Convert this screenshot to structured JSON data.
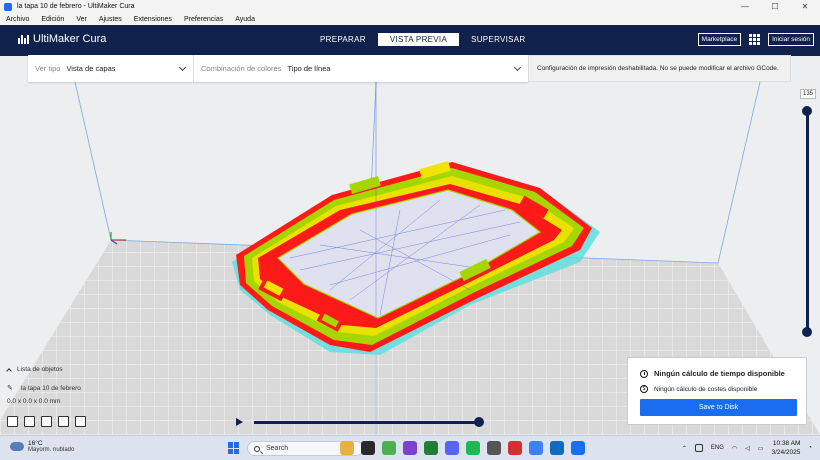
{
  "window": {
    "title": "la tapa 10 de febrero - UltiMaker Cura",
    "controls": [
      "—",
      "☐",
      "✕"
    ]
  },
  "menu": [
    "Archivo",
    "Edición",
    "Ver",
    "Ajustes",
    "Extensiones",
    "Preferencias",
    "Ayuda"
  ],
  "header": {
    "brand": "UltiMaker Cura",
    "stages": [
      "PREPARAR",
      "VISTA PREVIA",
      "SUPERVISAR"
    ],
    "active_stage": "VISTA PREVIA",
    "marketplace": "Marketplace",
    "signin": "Iniciar sesión"
  },
  "viewbar": {
    "view_type_label": "Ver tipo",
    "view_type_value": "Vista de capas",
    "color_scheme_label": "Combinación de colores",
    "color_scheme_value": "Tipo de línea",
    "notice": "Configuración de impresión deshabilitada. No se puede modificar el archivo GCode."
  },
  "layer_slider": {
    "current_layer": "135",
    "upper_fraction": 1.0,
    "lower_fraction": 0.0
  },
  "object_list": {
    "toggle_label": "Lista de objetos",
    "object_name": "la tapa 10 de febrero",
    "dimensions": "0.0 x 0.0 x 0.0 mm"
  },
  "playback": {
    "progress_fraction": 1.0
  },
  "print_info": {
    "time_text": "Ningún cálculo de tiempo disponible",
    "cost_text": "Ningún cálculo de costes disponible",
    "save_button": "Save to Disk"
  },
  "taskbar": {
    "temperature": "16°C",
    "weather": "Mayorm. nublado",
    "search_placeholder": "Search",
    "language": "ENG",
    "time": "10:38 AM",
    "date": "3/24/2025"
  },
  "colors": {
    "header_bg": "#10214b",
    "accent": "#196ef0",
    "wall_outer": "#ff1a1a",
    "wall_inner": "#a6d600",
    "skin": "#f2e200",
    "support": "#60dede",
    "travel": "#4d5bd9",
    "build_plate": "#d9d9d9",
    "grid_line": "#ffffff"
  }
}
